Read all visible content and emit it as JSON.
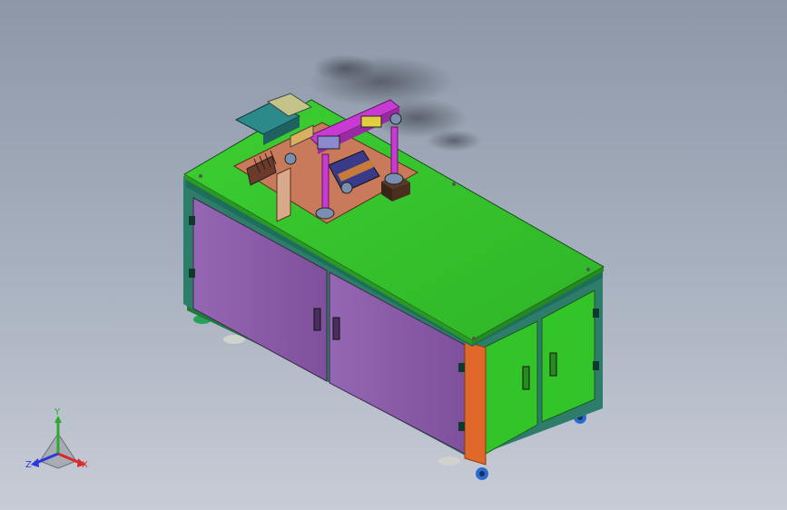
{
  "view": {
    "triad": {
      "x_label": "X",
      "y_label": "Y",
      "z_label": "Z"
    },
    "colors": {
      "table_top": "#33c42a",
      "front_panels": "#8a5ca6",
      "side_panels": "#33c42a",
      "corner_post": "#e0682a",
      "frame": "#2e7d6b",
      "mechanism_magenta": "#c83ad1",
      "mount_plate": "#c97a5a",
      "background": "#a9b2c0"
    }
  }
}
